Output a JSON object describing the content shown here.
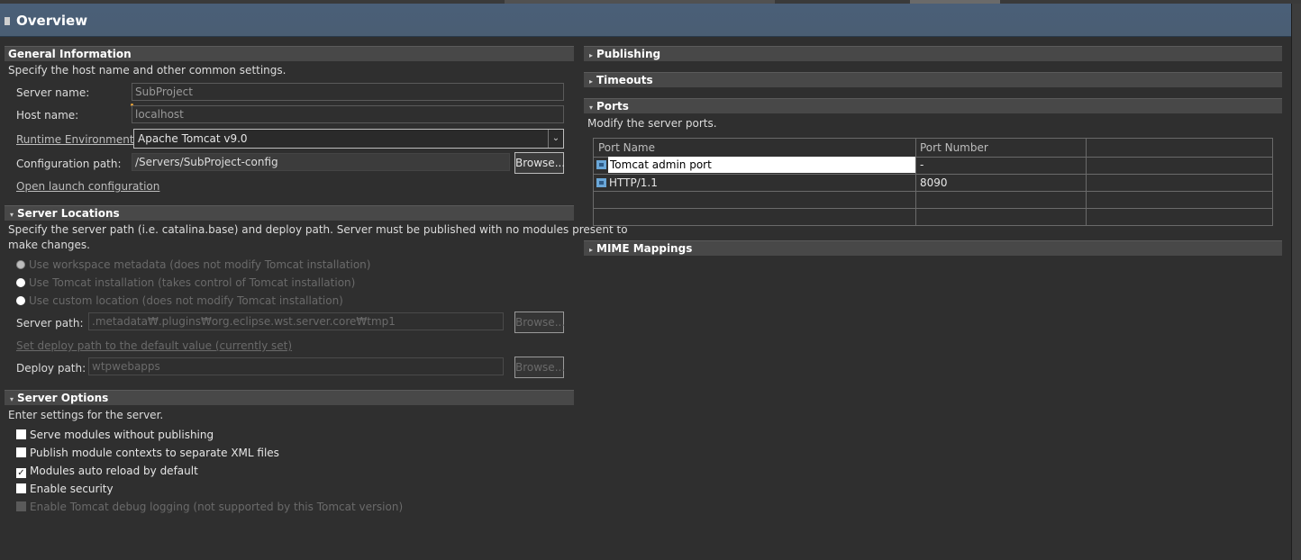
{
  "page": {
    "title": "Overview",
    "title_icon": "editor-page-icon"
  },
  "general": {
    "heading": "General Information",
    "description": "Specify the host name and other common settings.",
    "server_name_label": "Server name:",
    "server_name_value": "SubProject",
    "host_name_label": "Host name:",
    "host_name_value": "localhost",
    "runtime_label": "Runtime Environment:",
    "runtime_value": "Apache Tomcat v9.0",
    "config_path_label": "Configuration path:",
    "config_path_value": "/Servers/SubProject-config",
    "browse_label": "Browse...",
    "open_launch_label": "Open launch configuration"
  },
  "locations": {
    "heading": "Server Locations",
    "description_line1": "Specify the server path (i.e. catalina.base) and deploy path. Server must be published with no modules present to",
    "description_line2": "make changes.",
    "radio_workspace": "Use workspace metadata (does not modify Tomcat installation)",
    "radio_tomcat": "Use Tomcat installation (takes control of Tomcat installation)",
    "radio_custom": "Use custom location (does not modify Tomcat installation)",
    "server_path_label": "Server path:",
    "server_path_value": ".metadata₩.plugins₩org.eclipse.wst.server.core₩tmp1",
    "browse_label": "Browse...",
    "set_deploy_label": "Set deploy path to the default value (currently set)",
    "deploy_path_label": "Deploy path:",
    "deploy_path_value": "wtpwebapps",
    "browse2_label": "Browse..."
  },
  "options": {
    "heading": "Server Options",
    "description": "Enter settings for the server.",
    "opt1": "Serve modules without publishing",
    "opt2": "Publish module contexts to separate XML files",
    "opt3": "Modules auto reload by default",
    "opt4": "Enable security",
    "opt5": "Enable Tomcat debug logging (not supported by this Tomcat version)",
    "check_mark": "✓"
  },
  "right": {
    "publishing": "Publishing",
    "timeouts": "Timeouts",
    "ports": "Ports",
    "ports_desc": "Modify the server ports.",
    "col_name": "Port Name",
    "col_number": "Port Number",
    "rows": [
      {
        "name": "Tomcat admin port",
        "number": "-"
      },
      {
        "name": "HTTP/1.1",
        "number": "8090"
      }
    ],
    "mime": "MIME Mappings"
  },
  "twisties": {
    "collapsed": "▸",
    "expanded": "▾",
    "combo_arrow": "⌄"
  }
}
